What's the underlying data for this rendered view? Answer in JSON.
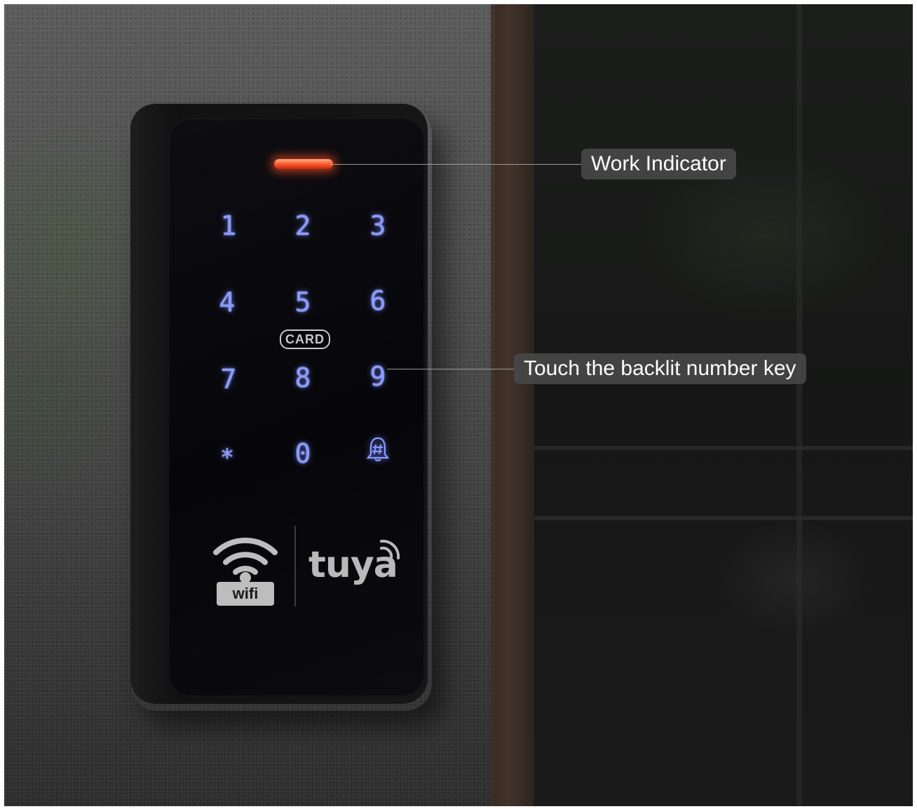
{
  "keypad": {
    "keys": [
      "1",
      "2",
      "3",
      "4",
      "5",
      "6",
      "7",
      "8",
      "9",
      "*",
      "0"
    ],
    "doorbell_key_icon": "bell-hash-icon",
    "card_label": "CARD",
    "wifi_label": "wifi",
    "brand_logo_text": "tuya",
    "indicator_color": "#ff4a20",
    "backlight_color": "#8c9cff"
  },
  "callouts": {
    "work_indicator": "Work Indicator",
    "backlit_keys": "Touch the backlit number key"
  }
}
